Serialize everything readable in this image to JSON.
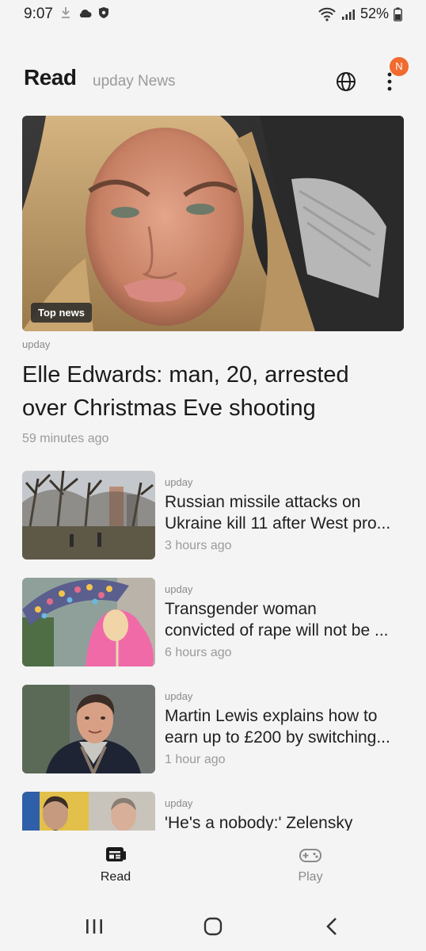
{
  "status_bar": {
    "time": "9:07",
    "battery": "52%",
    "icons": [
      "download-icon",
      "cloud-icon",
      "shield-icon",
      "wifi-icon",
      "signal-icon",
      "battery-icon"
    ]
  },
  "header": {
    "title": "Read",
    "subtitle": "upday News",
    "notification_badge": "N",
    "badge_color": "#f26a2e"
  },
  "hero": {
    "tag": "Top news",
    "source": "upday",
    "title_lines": [
      "Elle Edwards: man, 20, arrested",
      "over Christmas Eve shooting"
    ],
    "time": "59 minutes ago"
  },
  "news": [
    {
      "source": "upday",
      "title_lines": [
        "Russian missile attacks on",
        "Ukraine kill 11 after West pro..."
      ],
      "time": "3 hours ago"
    },
    {
      "source": "upday",
      "title_lines": [
        "Transgender woman",
        "convicted of rape will not be ..."
      ],
      "time": "6 hours ago"
    },
    {
      "source": "upday",
      "title_lines": [
        "Martin Lewis explains how to",
        "earn up to £200 by switching..."
      ],
      "time": "1 hour ago"
    },
    {
      "source": "upday",
      "title_lines": [
        "'He's a nobody:' Zelensky",
        ""
      ],
      "time": ""
    }
  ],
  "bottom_nav": {
    "items": [
      {
        "label": "Read",
        "icon": "news-icon",
        "active": true
      },
      {
        "label": "Play",
        "icon": "gamepad-icon",
        "active": false
      }
    ]
  },
  "system_nav": [
    "recents-icon",
    "home-icon",
    "back-icon"
  ]
}
